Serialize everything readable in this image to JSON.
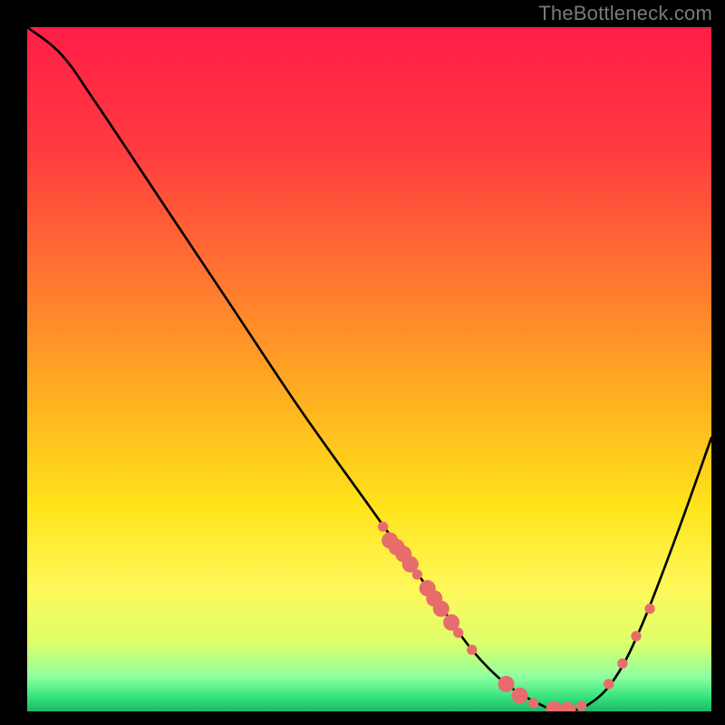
{
  "watermark": "TheBottleneck.com",
  "gradient_stops": [
    {
      "offset": 0,
      "color": "#ff1d47"
    },
    {
      "offset": 18,
      "color": "#ff3b3f"
    },
    {
      "offset": 38,
      "color": "#ff7a2f"
    },
    {
      "offset": 55,
      "color": "#ffb21f"
    },
    {
      "offset": 70,
      "color": "#ffe31a"
    },
    {
      "offset": 82,
      "color": "#fff85a"
    },
    {
      "offset": 90,
      "color": "#dcff6a"
    },
    {
      "offset": 95,
      "color": "#8dffa0"
    },
    {
      "offset": 98,
      "color": "#34e27c"
    },
    {
      "offset": 100,
      "color": "#1db568"
    }
  ],
  "marker_color": "#e76d6d",
  "marker_radius_small": 0.75,
  "marker_radius_big": 1.2,
  "chart_data": {
    "type": "line",
    "title": "",
    "xlabel": "",
    "ylabel": "",
    "xlim": [
      0,
      100
    ],
    "ylim": [
      0,
      100
    ],
    "curve": [
      {
        "x": 0,
        "y": 100
      },
      {
        "x": 5,
        "y": 96
      },
      {
        "x": 10,
        "y": 89
      },
      {
        "x": 20,
        "y": 74
      },
      {
        "x": 30,
        "y": 59
      },
      {
        "x": 40,
        "y": 44
      },
      {
        "x": 50,
        "y": 30
      },
      {
        "x": 55,
        "y": 23
      },
      {
        "x": 60,
        "y": 16
      },
      {
        "x": 65,
        "y": 9
      },
      {
        "x": 70,
        "y": 4
      },
      {
        "x": 75,
        "y": 1
      },
      {
        "x": 78,
        "y": 0
      },
      {
        "x": 82,
        "y": 1
      },
      {
        "x": 86,
        "y": 5
      },
      {
        "x": 90,
        "y": 13
      },
      {
        "x": 95,
        "y": 26
      },
      {
        "x": 100,
        "y": 40
      }
    ],
    "markers": [
      {
        "x": 52,
        "y": 27,
        "r": "small"
      },
      {
        "x": 53,
        "y": 25,
        "r": "big"
      },
      {
        "x": 54,
        "y": 24,
        "r": "big"
      },
      {
        "x": 55,
        "y": 23,
        "r": "big"
      },
      {
        "x": 56,
        "y": 21.5,
        "r": "big"
      },
      {
        "x": 57,
        "y": 20,
        "r": "small"
      },
      {
        "x": 58.5,
        "y": 18,
        "r": "big"
      },
      {
        "x": 59.5,
        "y": 16.5,
        "r": "big"
      },
      {
        "x": 60.5,
        "y": 15,
        "r": "big"
      },
      {
        "x": 62,
        "y": 13,
        "r": "big"
      },
      {
        "x": 63,
        "y": 11.5,
        "r": "small"
      },
      {
        "x": 65,
        "y": 9,
        "r": "small"
      },
      {
        "x": 70,
        "y": 4,
        "r": "big"
      },
      {
        "x": 72,
        "y": 2.3,
        "r": "big"
      },
      {
        "x": 74,
        "y": 1.2,
        "r": "small"
      },
      {
        "x": 77,
        "y": 0.3,
        "r": "big"
      },
      {
        "x": 79,
        "y": 0.2,
        "r": "big"
      },
      {
        "x": 81,
        "y": 0.8,
        "r": "small"
      },
      {
        "x": 85,
        "y": 4,
        "r": "small"
      },
      {
        "x": 87,
        "y": 7,
        "r": "small"
      },
      {
        "x": 89,
        "y": 11,
        "r": "small"
      },
      {
        "x": 91,
        "y": 15,
        "r": "small"
      }
    ]
  }
}
